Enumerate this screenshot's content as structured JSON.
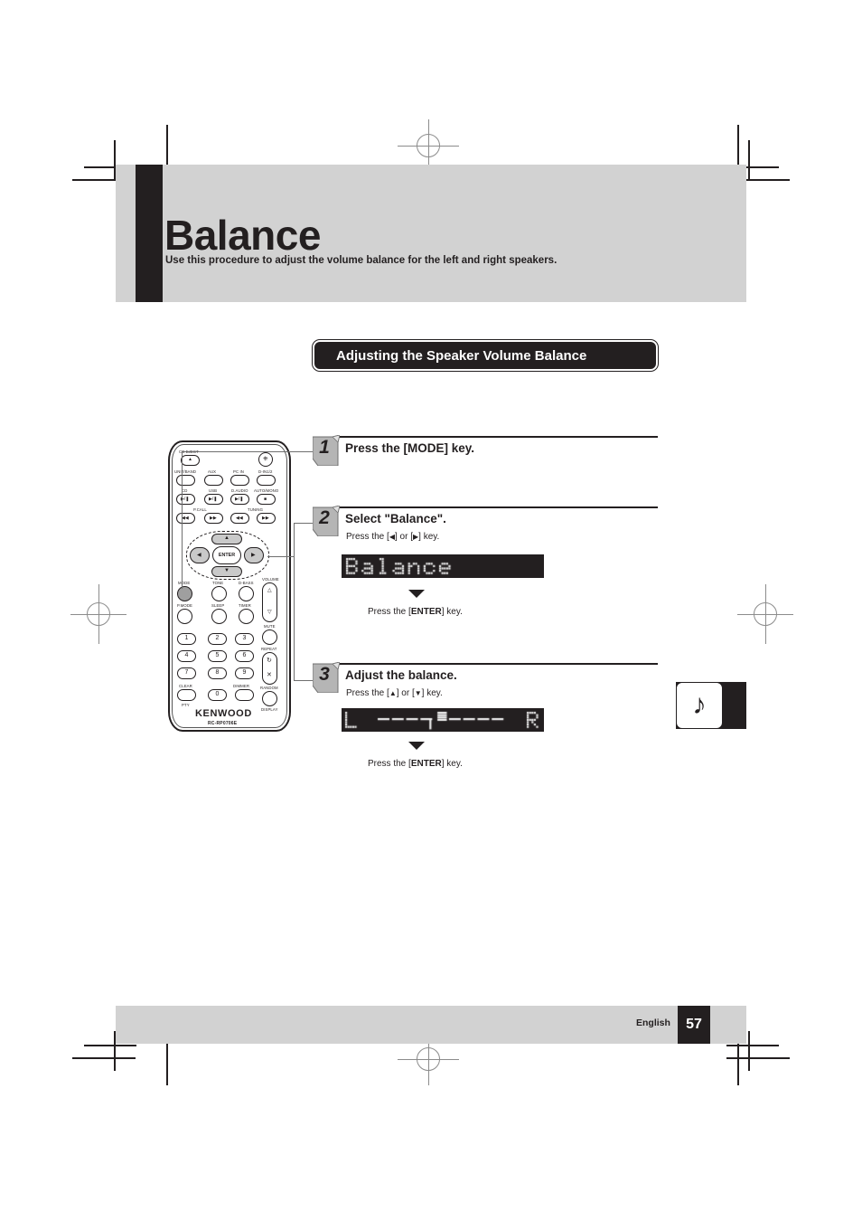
{
  "page": {
    "title": "Balance",
    "subtitle": "Use this procedure to adjust the volume balance for the left and right speakers.",
    "section_title": "Adjusting the Speaker Volume Balance",
    "footer_language": "English",
    "footer_page_number": "57",
    "tab_icon": "music-note-icon",
    "accent_dark": "#231f20",
    "band_gray": "#d2d2d2"
  },
  "steps": [
    {
      "number": "1",
      "title": "Press the [MODE] key.",
      "instruction": "",
      "display_text": "",
      "enter_note": ""
    },
    {
      "number": "2",
      "title": "Select \"Balance\".",
      "instruction_pre": "Press the [",
      "instruction_mid": "] or [",
      "instruction_post": "] key.",
      "instruction_left_glyph": "◀",
      "instruction_right_glyph": "▶",
      "display_text": "Balance",
      "display_type": "text",
      "enter_note_pre": "Press the [",
      "enter_note_key": "ENTER",
      "enter_note_post": "] key.",
      "arrow": "down-triangle"
    },
    {
      "number": "3",
      "title": "Adjust the balance.",
      "instruction_pre": "Press the [",
      "instruction_mid": "] or [",
      "instruction_post": "] key.",
      "instruction_left_glyph": "▲",
      "instruction_right_glyph": "▼",
      "display_left_label": "L",
      "display_right_label": "R",
      "display_type": "balance-bar",
      "display_segments": 9,
      "display_center_index": 4,
      "enter_note_pre": "Press the [",
      "enter_note_key": "ENTER",
      "enter_note_post": "] key.",
      "arrow": "down-triangle"
    }
  ],
  "remote": {
    "brand": "KENWOOD",
    "model": "RC-RP0706E",
    "labels": {
      "cd_eject": "CD EJECT",
      "power": "power-icon",
      "unit_band": "UNIT/BAND",
      "aux": "AUX",
      "pc_in": "PC IN",
      "d_in1_2": "D-IN1/2",
      "cd": "CD",
      "usb": "USB",
      "d_audio": "D.AUDIO",
      "auto_mono": "AUTO/MONO",
      "p_call": "P.CALL",
      "tuning": "TUNING",
      "enter": "ENTER",
      "mode": "MODE",
      "tone": "TONE",
      "d_bass": "D-BASS",
      "pmode": "P.MODE",
      "sleep": "SLEEP",
      "timer": "TIMER",
      "volume": "VOLUME",
      "mute": "MUTE",
      "repeat": "REPEAT",
      "random": "RANDOM",
      "clear": "CLEAR",
      "dimmer": "DIMMER",
      "display": "DISPLAY",
      "pty": "PTY"
    },
    "keypad": [
      "1",
      "2",
      "3",
      "4",
      "5",
      "6",
      "7",
      "8",
      "9",
      "0"
    ]
  }
}
